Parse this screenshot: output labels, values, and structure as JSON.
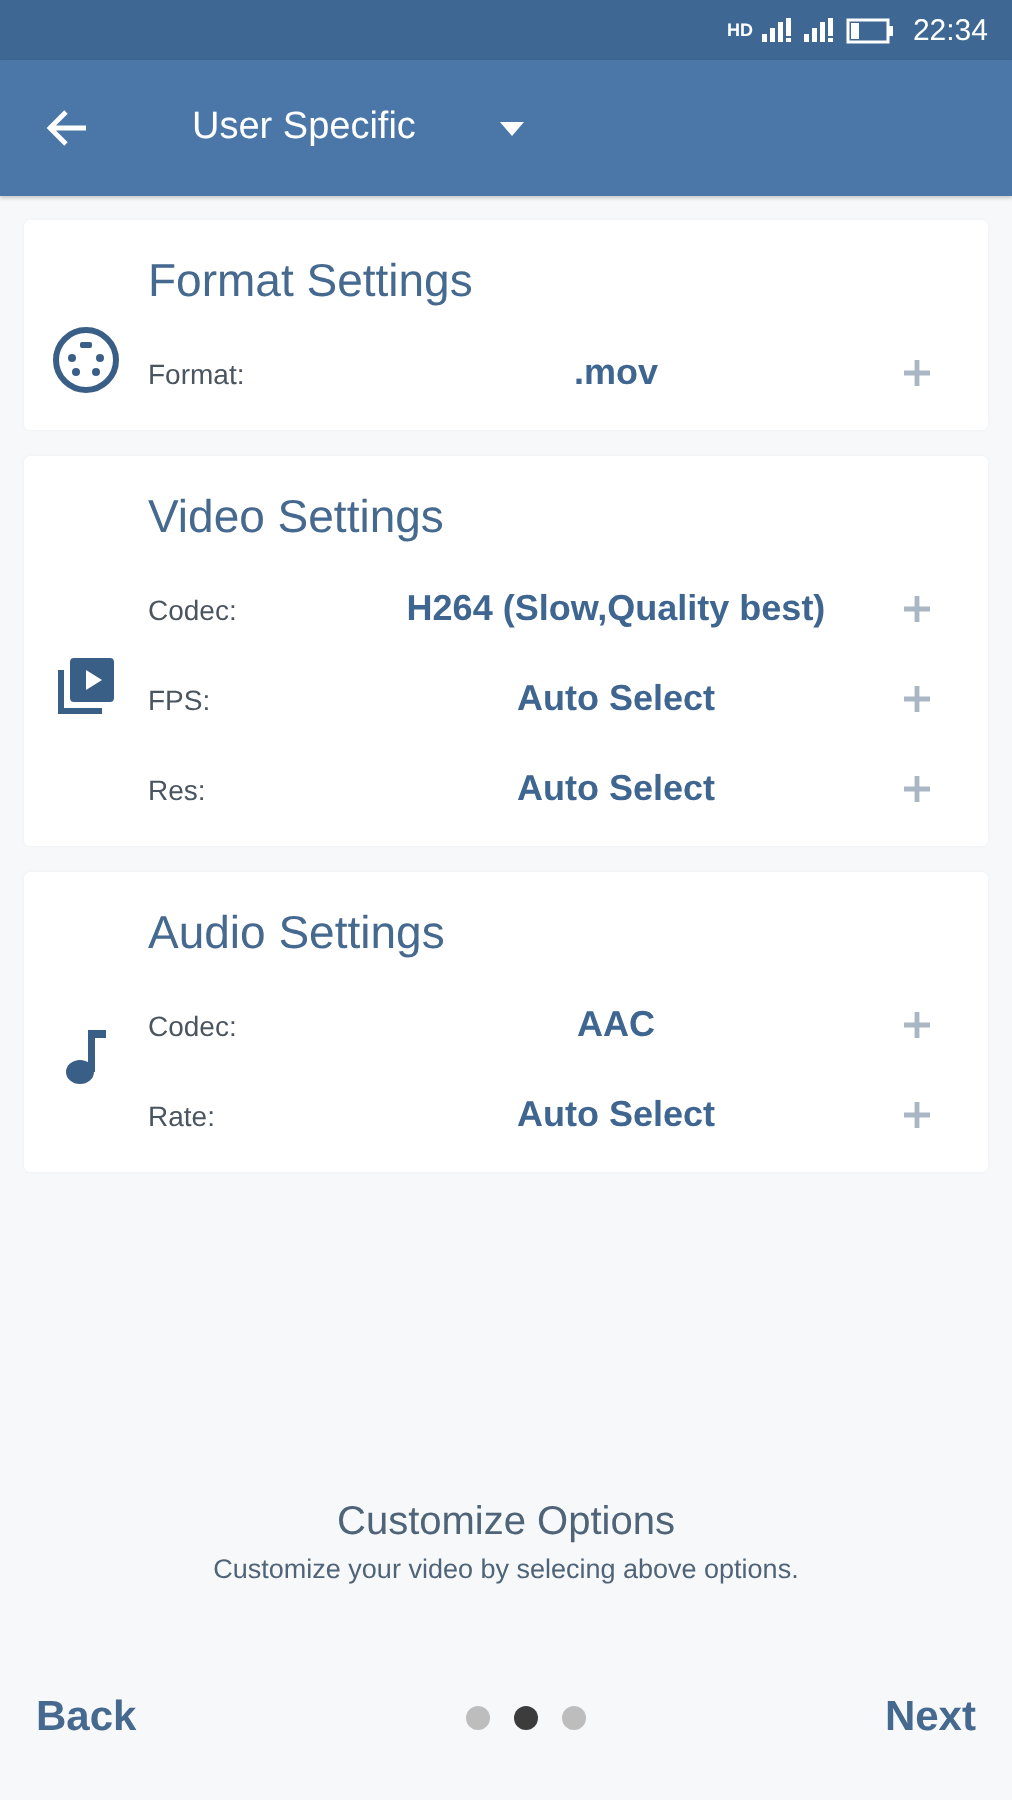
{
  "status_bar": {
    "network_label": "HD",
    "time": "22:34"
  },
  "app_bar": {
    "title": "User Specific"
  },
  "sections": [
    {
      "kind": "format",
      "title": "Format Settings",
      "rows": [
        {
          "label": "Format:",
          "value": ".mov"
        }
      ]
    },
    {
      "kind": "video",
      "title": "Video Settings",
      "rows": [
        {
          "label": "Codec:",
          "value": "H264 (Slow,Quality best)"
        },
        {
          "label": "FPS:",
          "value": "Auto Select"
        },
        {
          "label": "Res:",
          "value": "Auto Select"
        }
      ]
    },
    {
      "kind": "audio",
      "title": "Audio Settings",
      "rows": [
        {
          "label": "Codec:",
          "value": "AAC"
        },
        {
          "label": "Rate:",
          "value": "Auto Select"
        }
      ]
    }
  ],
  "footer": {
    "title": "Customize Options",
    "subtitle": "Customize your video by selecing above options."
  },
  "pager": {
    "back": "Back",
    "next": "Next",
    "dots": [
      {
        "selected": false
      },
      {
        "selected": true
      },
      {
        "selected": false
      }
    ]
  }
}
